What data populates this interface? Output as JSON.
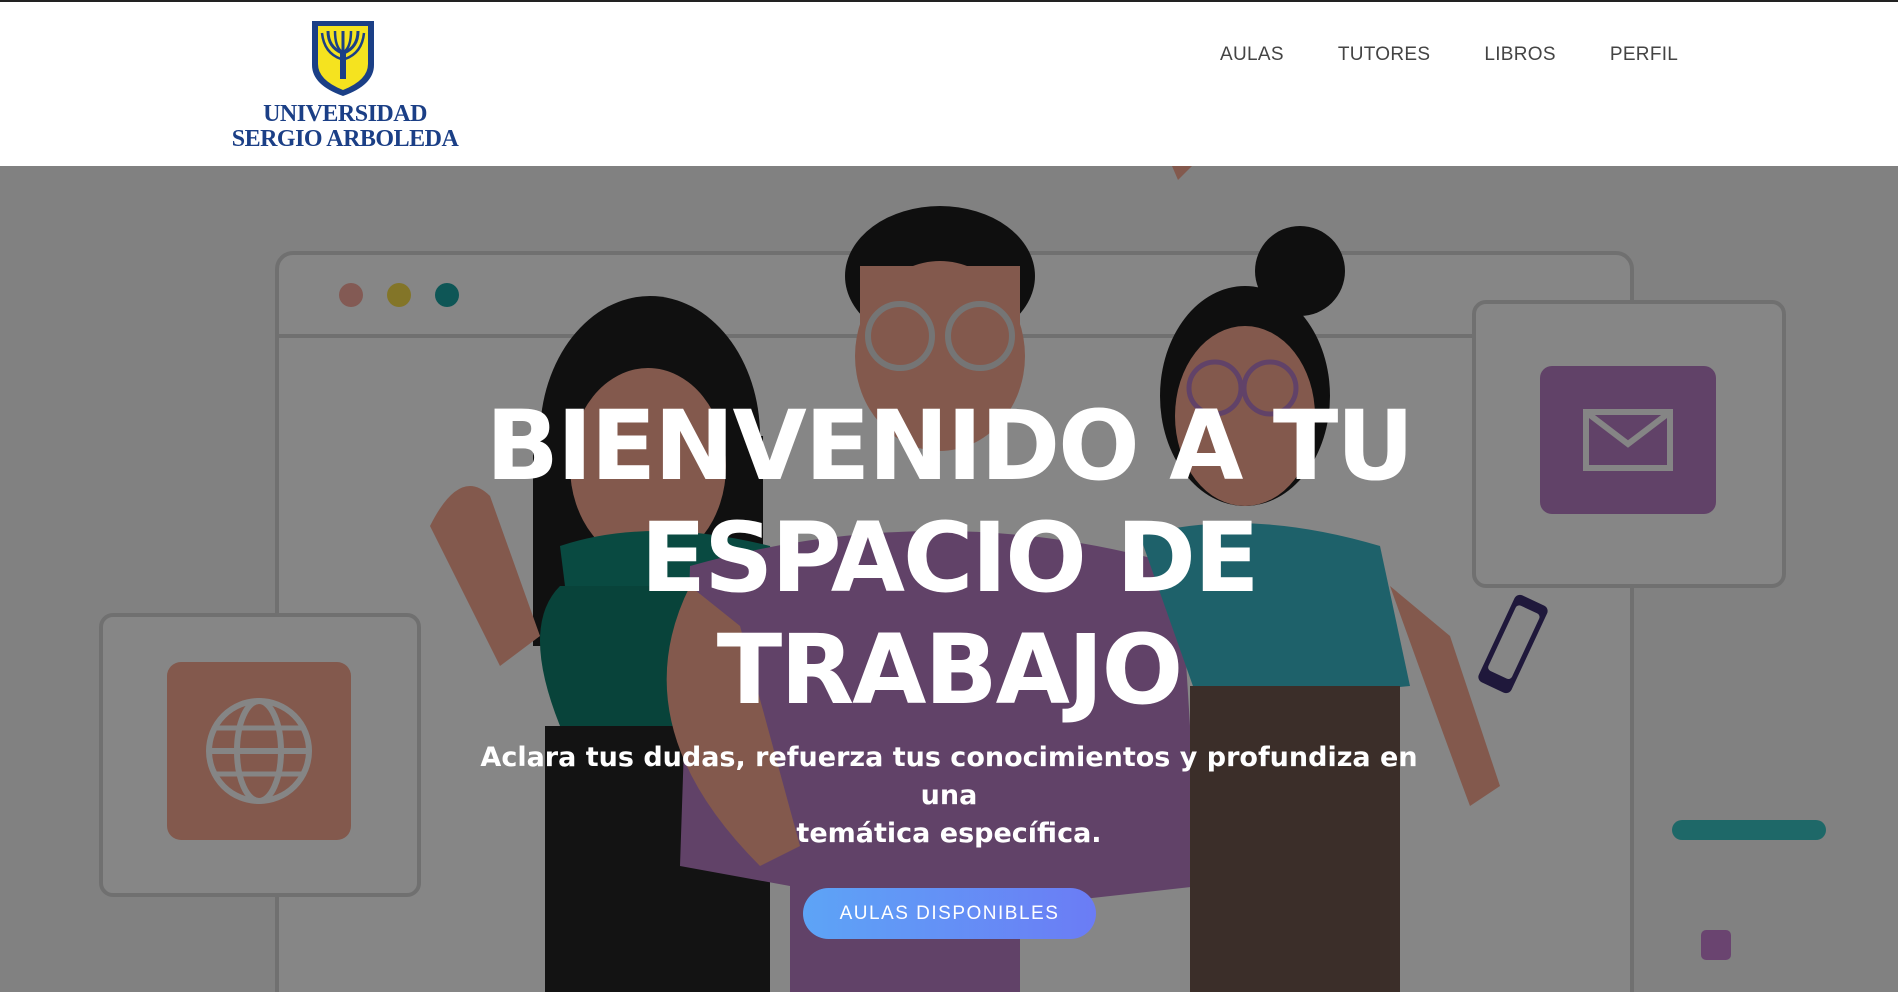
{
  "brand": {
    "line1": "UNIVERSIDAD",
    "line2": "SERGIO ARBOLEDA",
    "logo_icon": "shield-tree-icon",
    "colors": {
      "navy": "#1b3f86",
      "yellow": "#f5e31f"
    }
  },
  "nav": {
    "items": [
      {
        "label": "AULAS"
      },
      {
        "label": "TUTORES"
      },
      {
        "label": "LIBROS"
      },
      {
        "label": "PERFIL"
      }
    ]
  },
  "hero": {
    "title_line1": "BIENVENIDO A TU",
    "title_line2": "ESPACIO DE",
    "title_line3": "TRABAJO",
    "subtitle_line1": "Aclara tus dudas, refuerza tus conocimientos y profundiza en una",
    "subtitle_line2": "temática específica.",
    "cta_label": "AULAS DISPONIBLES",
    "background_icons": [
      "globe-icon",
      "envelope-icon",
      "phone-icon"
    ],
    "colors": {
      "cta_start": "#5da4f6",
      "cta_end": "#6b7cf5",
      "overlay": "rgba(0,0,0,0.46)"
    }
  }
}
